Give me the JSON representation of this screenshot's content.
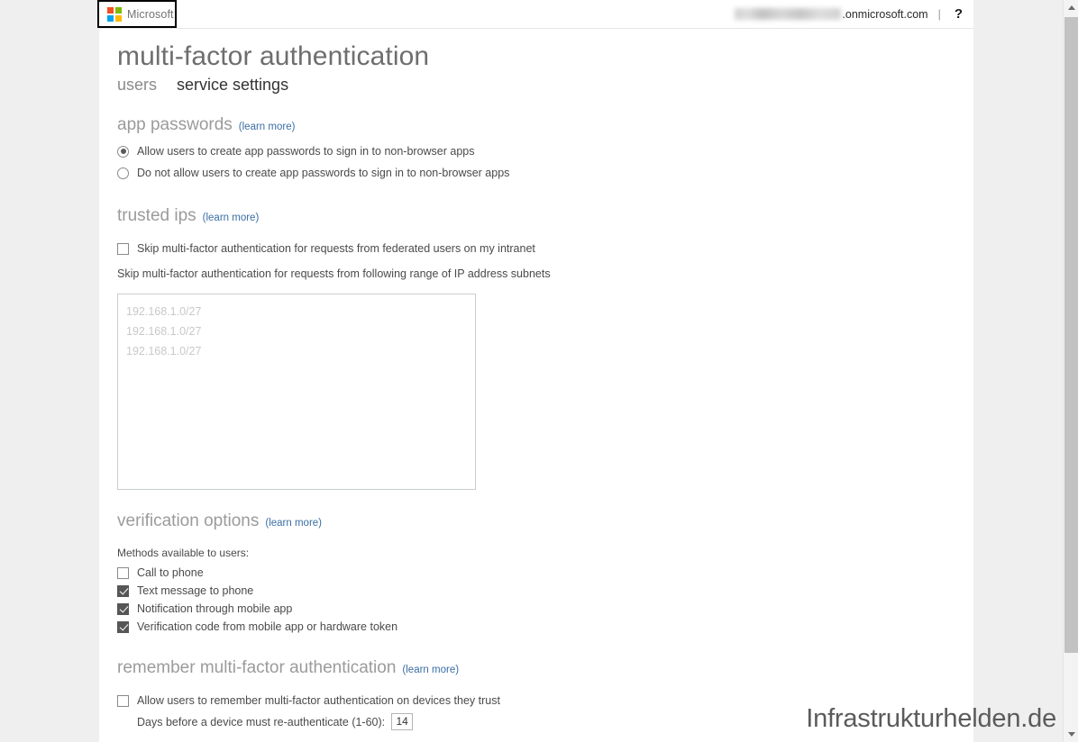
{
  "header": {
    "logo_name": "Microsoft",
    "tenant_redacted": true,
    "tenant_domain": ".onmicrosoft.com",
    "separator": "|",
    "help_label": "?"
  },
  "page": {
    "title": "multi-factor authentication",
    "tabs": [
      {
        "label": "users",
        "active": false
      },
      {
        "label": "service settings",
        "active": true
      }
    ]
  },
  "learn_more_label": "(learn more)",
  "sections": {
    "app_passwords": {
      "title": "app passwords",
      "options": [
        {
          "label": "Allow users to create app passwords to sign in to non-browser apps",
          "selected": true
        },
        {
          "label": "Do not allow users to create app passwords to sign in to non-browser apps",
          "selected": false
        }
      ]
    },
    "trusted_ips": {
      "title": "trusted ips",
      "federated_checkbox": {
        "label": "Skip multi-factor authentication for requests from federated users on my intranet",
        "checked": false
      },
      "subnets_label": "Skip multi-factor authentication for requests from following range of IP address subnets",
      "subnets_value": "",
      "subnets_placeholder_lines": [
        "192.168.1.0/27",
        "192.168.1.0/27",
        "192.168.1.0/27"
      ]
    },
    "verification_options": {
      "title": "verification options",
      "methods_label": "Methods available to users:",
      "methods": [
        {
          "label": "Call to phone",
          "checked": false
        },
        {
          "label": "Text message to phone",
          "checked": true
        },
        {
          "label": "Notification through mobile app",
          "checked": true
        },
        {
          "label": "Verification code from mobile app or hardware token",
          "checked": true
        }
      ]
    },
    "remember_mfa": {
      "title": "remember multi-factor authentication",
      "allow_checkbox": {
        "label": "Allow users to remember multi-factor authentication on devices they trust",
        "checked": false
      },
      "days_label": "Days before a device must re-authenticate (1-60):",
      "days_value": "14"
    }
  },
  "watermark": "Infrastrukturhelden.de",
  "colors": {
    "accent_link": "#3a6ea5",
    "title_gray": "#6e6e6e",
    "section_gray": "#9b9b9b",
    "checkbox_fill": "#565656",
    "ms_red": "#f25022",
    "ms_green": "#7fba00",
    "ms_blue": "#00a4ef",
    "ms_yellow": "#ffb900"
  }
}
